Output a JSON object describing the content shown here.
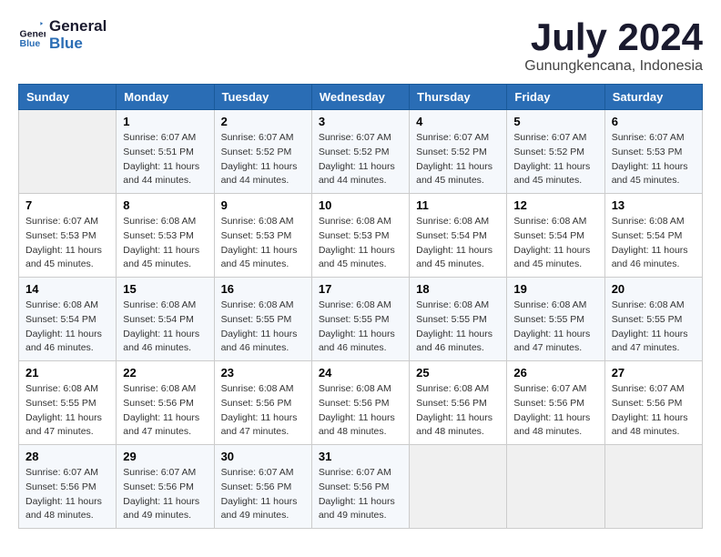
{
  "logo": {
    "line1": "General",
    "line2": "Blue"
  },
  "title": "July 2024",
  "location": "Gunungkencana, Indonesia",
  "days_header": [
    "Sunday",
    "Monday",
    "Tuesday",
    "Wednesday",
    "Thursday",
    "Friday",
    "Saturday"
  ],
  "weeks": [
    [
      {
        "day": "",
        "info": ""
      },
      {
        "day": "1",
        "info": "Sunrise: 6:07 AM\nSunset: 5:51 PM\nDaylight: 11 hours\nand 44 minutes."
      },
      {
        "day": "2",
        "info": "Sunrise: 6:07 AM\nSunset: 5:52 PM\nDaylight: 11 hours\nand 44 minutes."
      },
      {
        "day": "3",
        "info": "Sunrise: 6:07 AM\nSunset: 5:52 PM\nDaylight: 11 hours\nand 44 minutes."
      },
      {
        "day": "4",
        "info": "Sunrise: 6:07 AM\nSunset: 5:52 PM\nDaylight: 11 hours\nand 45 minutes."
      },
      {
        "day": "5",
        "info": "Sunrise: 6:07 AM\nSunset: 5:52 PM\nDaylight: 11 hours\nand 45 minutes."
      },
      {
        "day": "6",
        "info": "Sunrise: 6:07 AM\nSunset: 5:53 PM\nDaylight: 11 hours\nand 45 minutes."
      }
    ],
    [
      {
        "day": "7",
        "info": "Sunrise: 6:07 AM\nSunset: 5:53 PM\nDaylight: 11 hours\nand 45 minutes."
      },
      {
        "day": "8",
        "info": "Sunrise: 6:08 AM\nSunset: 5:53 PM\nDaylight: 11 hours\nand 45 minutes."
      },
      {
        "day": "9",
        "info": "Sunrise: 6:08 AM\nSunset: 5:53 PM\nDaylight: 11 hours\nand 45 minutes."
      },
      {
        "day": "10",
        "info": "Sunrise: 6:08 AM\nSunset: 5:53 PM\nDaylight: 11 hours\nand 45 minutes."
      },
      {
        "day": "11",
        "info": "Sunrise: 6:08 AM\nSunset: 5:54 PM\nDaylight: 11 hours\nand 45 minutes."
      },
      {
        "day": "12",
        "info": "Sunrise: 6:08 AM\nSunset: 5:54 PM\nDaylight: 11 hours\nand 45 minutes."
      },
      {
        "day": "13",
        "info": "Sunrise: 6:08 AM\nSunset: 5:54 PM\nDaylight: 11 hours\nand 46 minutes."
      }
    ],
    [
      {
        "day": "14",
        "info": "Sunrise: 6:08 AM\nSunset: 5:54 PM\nDaylight: 11 hours\nand 46 minutes."
      },
      {
        "day": "15",
        "info": "Sunrise: 6:08 AM\nSunset: 5:54 PM\nDaylight: 11 hours\nand 46 minutes."
      },
      {
        "day": "16",
        "info": "Sunrise: 6:08 AM\nSunset: 5:55 PM\nDaylight: 11 hours\nand 46 minutes."
      },
      {
        "day": "17",
        "info": "Sunrise: 6:08 AM\nSunset: 5:55 PM\nDaylight: 11 hours\nand 46 minutes."
      },
      {
        "day": "18",
        "info": "Sunrise: 6:08 AM\nSunset: 5:55 PM\nDaylight: 11 hours\nand 46 minutes."
      },
      {
        "day": "19",
        "info": "Sunrise: 6:08 AM\nSunset: 5:55 PM\nDaylight: 11 hours\nand 47 minutes."
      },
      {
        "day": "20",
        "info": "Sunrise: 6:08 AM\nSunset: 5:55 PM\nDaylight: 11 hours\nand 47 minutes."
      }
    ],
    [
      {
        "day": "21",
        "info": "Sunrise: 6:08 AM\nSunset: 5:55 PM\nDaylight: 11 hours\nand 47 minutes."
      },
      {
        "day": "22",
        "info": "Sunrise: 6:08 AM\nSunset: 5:56 PM\nDaylight: 11 hours\nand 47 minutes."
      },
      {
        "day": "23",
        "info": "Sunrise: 6:08 AM\nSunset: 5:56 PM\nDaylight: 11 hours\nand 47 minutes."
      },
      {
        "day": "24",
        "info": "Sunrise: 6:08 AM\nSunset: 5:56 PM\nDaylight: 11 hours\nand 48 minutes."
      },
      {
        "day": "25",
        "info": "Sunrise: 6:08 AM\nSunset: 5:56 PM\nDaylight: 11 hours\nand 48 minutes."
      },
      {
        "day": "26",
        "info": "Sunrise: 6:07 AM\nSunset: 5:56 PM\nDaylight: 11 hours\nand 48 minutes."
      },
      {
        "day": "27",
        "info": "Sunrise: 6:07 AM\nSunset: 5:56 PM\nDaylight: 11 hours\nand 48 minutes."
      }
    ],
    [
      {
        "day": "28",
        "info": "Sunrise: 6:07 AM\nSunset: 5:56 PM\nDaylight: 11 hours\nand 48 minutes."
      },
      {
        "day": "29",
        "info": "Sunrise: 6:07 AM\nSunset: 5:56 PM\nDaylight: 11 hours\nand 49 minutes."
      },
      {
        "day": "30",
        "info": "Sunrise: 6:07 AM\nSunset: 5:56 PM\nDaylight: 11 hours\nand 49 minutes."
      },
      {
        "day": "31",
        "info": "Sunrise: 6:07 AM\nSunset: 5:56 PM\nDaylight: 11 hours\nand 49 minutes."
      },
      {
        "day": "",
        "info": ""
      },
      {
        "day": "",
        "info": ""
      },
      {
        "day": "",
        "info": ""
      }
    ]
  ]
}
